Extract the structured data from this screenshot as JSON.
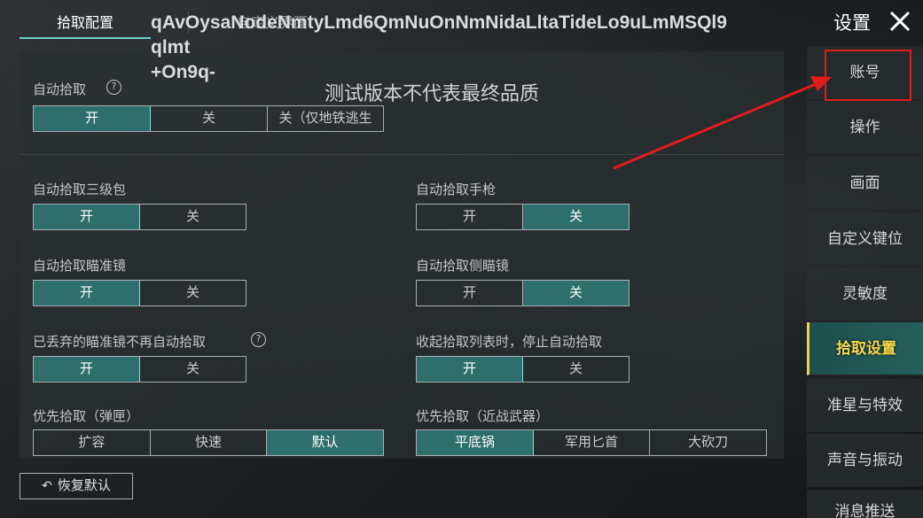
{
  "tabs": [
    {
      "label": "拾取配置"
    },
    {
      "label": "自定义界面"
    }
  ],
  "debug_text": "qAvOysaNodeNmtyLmd6QmNuOnNmNidaLltaTideLo9uLmMSQl9\nqlmt\n+On9q-",
  "test_note": "测试版本不代表最终品质",
  "settings": {
    "auto_pickup": {
      "label": "自动拾取",
      "options": [
        "开",
        "关",
        "关（仅地铁逃生"
      ],
      "selected": 0
    },
    "auto_pickup_lvl3_bag": {
      "label": "自动拾取三级包",
      "options": [
        "开",
        "关"
      ],
      "selected": 0
    },
    "auto_pickup_pistol": {
      "label": "自动拾取手枪",
      "options": [
        "开",
        "关"
      ],
      "selected": 1
    },
    "auto_pickup_scope": {
      "label": "自动拾取瞄准镜",
      "options": [
        "开",
        "关"
      ],
      "selected": 0
    },
    "auto_pickup_side_scope": {
      "label": "自动拾取侧瞄镜",
      "options": [
        "开",
        "关"
      ],
      "selected": 1
    },
    "discarded_scope": {
      "label": "已丢弃的瞄准镜不再自动拾取",
      "options": [
        "开",
        "关"
      ],
      "selected": 0
    },
    "collapse_list_stop": {
      "label": "收起拾取列表时，停止自动拾取",
      "options": [
        "开",
        "关"
      ],
      "selected": 0
    },
    "priority_mag": {
      "label": "优先拾取（弹匣）",
      "options": [
        "扩容",
        "快速",
        "默认"
      ],
      "selected": 2
    },
    "priority_melee": {
      "label": "优先拾取（近战武器）",
      "options": [
        "平底锅",
        "军用匕首",
        "大砍刀"
      ],
      "selected": 0
    }
  },
  "help_icon_glyph": "?",
  "restore_button": {
    "icon": "↶",
    "label": "恢复默认"
  },
  "sidebar": {
    "title": "设置",
    "items": [
      {
        "label": "账号"
      },
      {
        "label": "操作"
      },
      {
        "label": "画面"
      },
      {
        "label": "自定义键位"
      },
      {
        "label": "灵敏度"
      },
      {
        "label": "拾取设置"
      },
      {
        "label": "准星与特效"
      },
      {
        "label": "声音与振动"
      },
      {
        "label": "消息推送"
      }
    ],
    "active_index": 5
  },
  "colors": {
    "accent_teal": "#2e6f6d",
    "active_gold": "#f6d84a",
    "annotation_red": "#e11c1c"
  }
}
